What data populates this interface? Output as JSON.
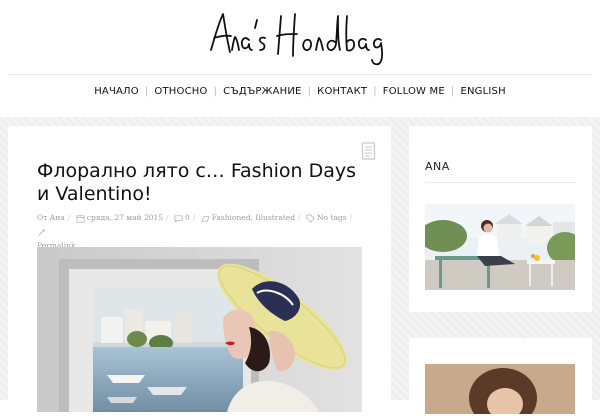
{
  "site": {
    "logo_text": "Ana's Handbag"
  },
  "nav": {
    "items": [
      {
        "label": "НАЧАЛО"
      },
      {
        "label": "ОТНОСНО"
      },
      {
        "label": "СЪДЪРЖАНИЕ"
      },
      {
        "label": "КОНТАКТ"
      },
      {
        "label": "FOLLOW ME"
      },
      {
        "label": "ENGLISH"
      }
    ],
    "separator": "|"
  },
  "post": {
    "title": "Флорално лято с… Fashion Days и Valentino!",
    "author": "От Ана",
    "date": "сряда, 27 май 2015",
    "comments": "0",
    "categories": "Fashioned, Illustrated",
    "tags": "No tags",
    "permalink": "Permalink",
    "meta_separator": "/",
    "format_icon": "document-icon"
  },
  "sidebar": {
    "widget_ana": {
      "title": "ANA"
    }
  },
  "colors": {
    "background": "#f3f3f3",
    "card": "#ffffff",
    "text": "#111111",
    "meta": "#9a9a9a",
    "hat": "#e9e39a",
    "lips": "#c0202a"
  }
}
